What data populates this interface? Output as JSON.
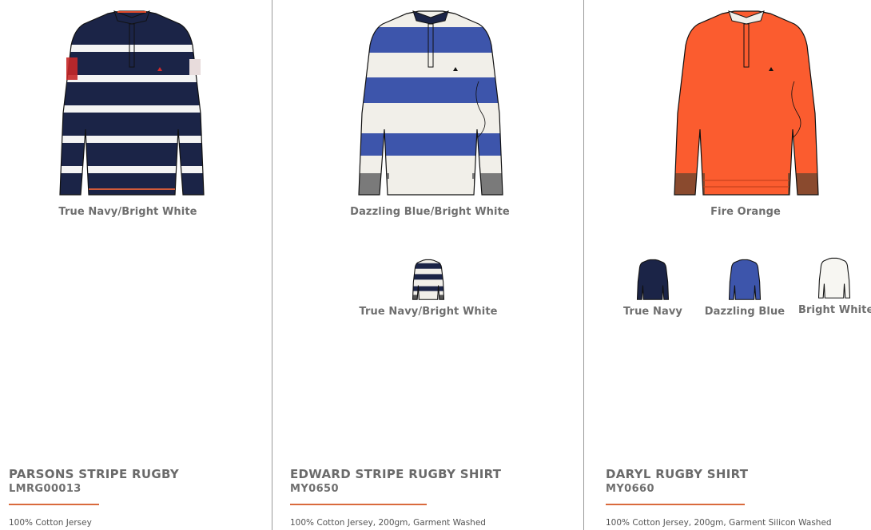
{
  "colors": {
    "accent_rule": "#d96a3c",
    "true_navy": "#1b2447",
    "bright_white": "#f1efe9",
    "dazzling_blue": "#3d55ab",
    "fire_orange": "#fb5c2f"
  },
  "products": [
    {
      "name": "PARSONS STRIPE RUGBY",
      "code": "LMRG00013",
      "description": "100% Cotton Jersey",
      "main_colorway": "True Navy/Bright White",
      "swatches": []
    },
    {
      "name": "EDWARD STRIPE RUGBY SHIRT",
      "code": "MY0650",
      "description": "100% Cotton Jersey, 200gm, Garment Washed",
      "main_colorway": "Dazzling Blue/Bright White",
      "swatches": [
        {
          "label": "True Navy/Bright White"
        }
      ]
    },
    {
      "name": "DARYL RUGBY SHIRT",
      "code": "MY0660",
      "description": "100% Cotton Jersey, 200gm, Garment Silicon Washed",
      "main_colorway": "Fire Orange",
      "swatches": [
        {
          "label": "True Navy"
        },
        {
          "label": "Dazzling Blue"
        },
        {
          "label": "Bright White"
        }
      ]
    }
  ]
}
